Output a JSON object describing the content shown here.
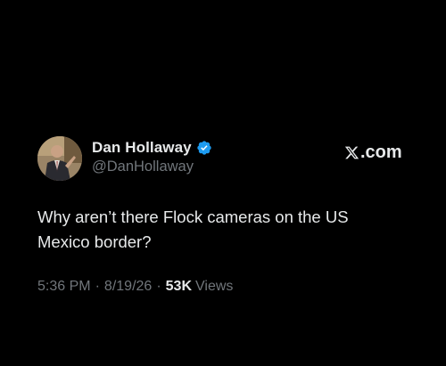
{
  "author": {
    "display_name": "Dan Hollaway",
    "handle": "@DanHollaway",
    "verified": true
  },
  "brand": {
    "logo_icon": "x-logo-icon",
    "suffix": ".com"
  },
  "tweet": {
    "text": "Why aren’t there Flock cameras on the US\nMexico border?"
  },
  "meta": {
    "time": "5:36 PM",
    "separator": "·",
    "date": "8/19/26",
    "views_count": "53K",
    "views_label": "Views"
  },
  "colors": {
    "background": "#000000",
    "primary_text": "#e7e9ea",
    "secondary_text": "#71767b",
    "verified_blue": "#1d9bf0"
  }
}
